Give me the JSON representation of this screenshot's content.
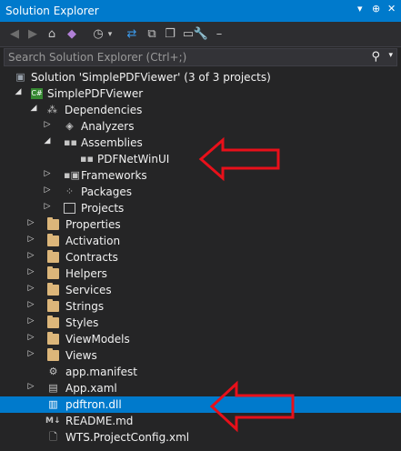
{
  "window": {
    "title": "Solution Explorer"
  },
  "title_controls": [
    "▾",
    "⊕",
    "✕"
  ],
  "search": {
    "placeholder": "Search Solution Explorer (Ctrl+;)"
  },
  "tree": [
    {
      "label": "Solution 'SimplePDFViewer' (3 of 3 projects)",
      "icon": "solution-icon",
      "expander": ""
    },
    {
      "label": "SimplePDFViewer",
      "icon": "csharp-project-icon",
      "expander": "▴"
    },
    {
      "label": "Dependencies",
      "icon": "dependencies-icon",
      "expander": "▴"
    },
    {
      "label": "Analyzers",
      "icon": "analyzers-icon",
      "expander": "▸"
    },
    {
      "label": "Assemblies",
      "icon": "assemblies-icon",
      "expander": "▴"
    },
    {
      "label": "PDFNetWinUI",
      "icon": "assembly-reference-icon",
      "expander": ""
    },
    {
      "label": "Frameworks",
      "icon": "frameworks-icon",
      "expander": "▸"
    },
    {
      "label": "Packages",
      "icon": "packages-icon",
      "expander": "▸"
    },
    {
      "label": "Projects",
      "icon": "projects-icon",
      "expander": "▸"
    },
    {
      "label": "Properties",
      "icon": "folder-icon",
      "expander": "▸"
    },
    {
      "label": "Activation",
      "icon": "folder-icon",
      "expander": "▸"
    },
    {
      "label": "Contracts",
      "icon": "folder-icon",
      "expander": "▸"
    },
    {
      "label": "Helpers",
      "icon": "folder-icon",
      "expander": "▸"
    },
    {
      "label": "Services",
      "icon": "folder-icon",
      "expander": "▸"
    },
    {
      "label": "Strings",
      "icon": "folder-icon",
      "expander": "▸"
    },
    {
      "label": "Styles",
      "icon": "folder-icon",
      "expander": "▸"
    },
    {
      "label": "ViewModels",
      "icon": "folder-icon",
      "expander": "▸"
    },
    {
      "label": "Views",
      "icon": "folder-icon",
      "expander": "▸"
    },
    {
      "label": "app.manifest",
      "icon": "manifest-icon",
      "expander": ""
    },
    {
      "label": "App.xaml",
      "icon": "xaml-icon",
      "expander": "▸"
    },
    {
      "label": "pdftron.dll",
      "icon": "dll-icon",
      "expander": ""
    },
    {
      "label": "README.md",
      "icon": "markdown-icon",
      "expander": ""
    },
    {
      "label": "WTS.ProjectConfig.xml",
      "icon": "xml-file-icon",
      "expander": ""
    }
  ],
  "selected_item": "pdftron.dll",
  "colors": {
    "accent": "#007acc",
    "background": "#252526",
    "annotation_arrow": "#e8101a",
    "folder": "#dcb67a"
  }
}
